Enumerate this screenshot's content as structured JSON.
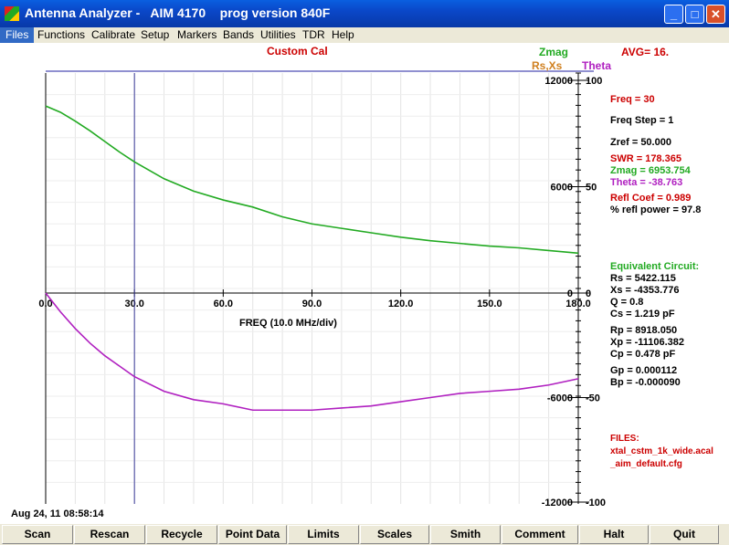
{
  "window": {
    "title": "Antenna Analyzer -   AIM 4170    prog version 840F",
    "controls": [
      "_",
      "□",
      "✕"
    ]
  },
  "menu": [
    "Files",
    "Functions",
    "Calibrate",
    "Setup",
    "Markers",
    "Bands",
    "Utilities",
    "TDR",
    "Help"
  ],
  "header": {
    "custom_cal": "Custom Cal",
    "legend_zmag": "Zmag",
    "legend_rsxs": "Rs,Xs",
    "legend_theta": "Theta",
    "avg": "AVG=  16."
  },
  "colors": {
    "zmag": "#22aa22",
    "theta": "#b020c0",
    "rsxs": "#d08020",
    "red_text": "#cc0000",
    "cursor": "#3a3a9a",
    "top_line": "#9090d0"
  },
  "chart_data": [
    {
      "type": "line",
      "name": "upper",
      "xlabel": "FREQ (10.0 MHz/div)",
      "x_ticks": [
        "0.0",
        "30.0",
        "60.0",
        "90.0",
        "120.0",
        "150.0",
        "180.0"
      ],
      "xlim": [
        0,
        180
      ],
      "left_ticks": [
        "12000",
        "6000",
        "0"
      ],
      "right_ticks": [
        "100",
        "50",
        "0"
      ],
      "ylim": [
        0,
        12000
      ],
      "series": [
        {
          "name": "Zmag",
          "x": [
            0,
            5,
            10,
            15,
            20,
            25,
            30,
            40,
            50,
            60,
            70,
            80,
            90,
            100,
            110,
            120,
            130,
            140,
            150,
            160,
            170,
            180
          ],
          "y": [
            10550,
            10200,
            9700,
            9150,
            8550,
            7950,
            7400,
            6450,
            5750,
            5250,
            4850,
            4300,
            3900,
            3650,
            3400,
            3150,
            2950,
            2800,
            2650,
            2550,
            2400,
            2250
          ]
        }
      ],
      "cursor_x": 30
    },
    {
      "type": "line",
      "name": "lower",
      "left_ticks": [
        "-6000",
        "-12000"
      ],
      "right_ticks": [
        "-50",
        "-100"
      ],
      "ylim": [
        -100,
        0
      ],
      "series": [
        {
          "name": "Theta",
          "x": [
            0,
            5,
            10,
            15,
            20,
            25,
            30,
            40,
            50,
            60,
            70,
            80,
            90,
            100,
            110,
            120,
            130,
            140,
            150,
            160,
            170,
            180
          ],
          "y": [
            0,
            -9,
            -17,
            -24,
            -30,
            -35,
            -40,
            -47,
            -51,
            -53,
            -56,
            -56,
            -56,
            -55,
            -54,
            -52,
            -50,
            -48,
            -47,
            -46,
            -44,
            -41
          ]
        }
      ]
    }
  ],
  "readout": {
    "freq": "Freq = 30",
    "freq_step": "Freq Step = 1",
    "zref": "Zref =   50.000",
    "swr": "SWR  = 178.365",
    "zmag": "Zmag = 6953.754",
    "theta": "Theta =  -38.763",
    "refl_coef": "Refl Coef   = 0.989",
    "refl_power": "% refl power = 97.8",
    "eq_header": "Equivalent Circuit:",
    "rs": "Rs = 5422.115",
    "xs": "Xs = -4353.776",
    "q": "Q  =  0.8",
    "cs": "Cs =    1.219  pF",
    "rp": "Rp = 8918.050",
    "xp": "Xp = -11106.382",
    "cp": "Cp =    0.478  pF",
    "gp": "Gp =  0.000112",
    "bp": "Bp = -0.000090",
    "files_header": "FILES:",
    "file1": "xtal_cstm_1k_wide.acal",
    "file2": "_aim_default.cfg"
  },
  "datestamp": "Aug 24, 11   08:58:14",
  "buttons": [
    "Scan",
    "Rescan",
    "Recycle",
    "Point Data",
    "Limits",
    "Scales",
    "Smith",
    "Comment",
    "Halt",
    "Quit"
  ]
}
